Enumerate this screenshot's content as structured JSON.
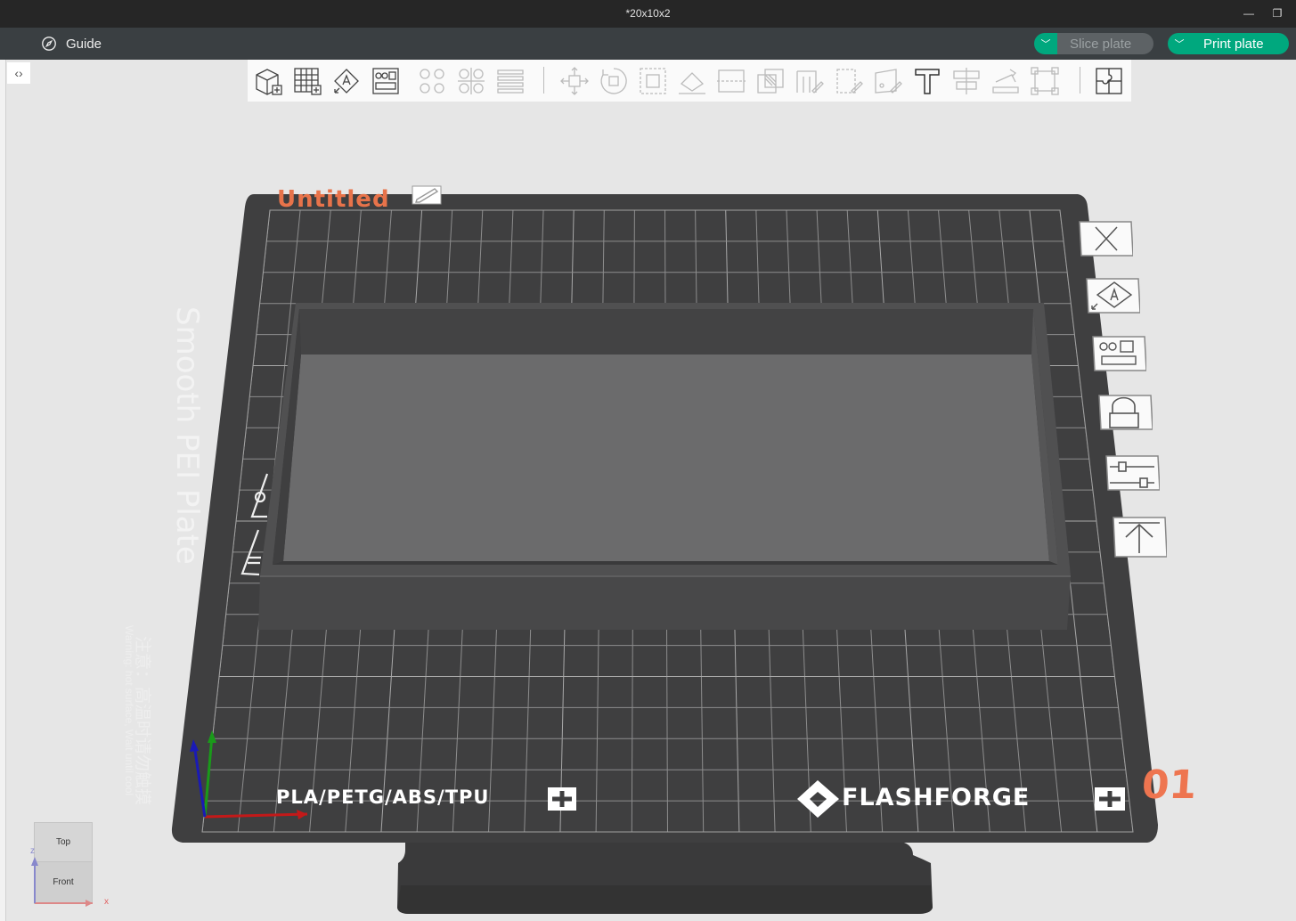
{
  "window": {
    "title": "*20x10x2",
    "minimize_glyph": "—",
    "restore_glyph": "❐"
  },
  "menubar": {
    "guide_label": "Guide",
    "guide_icon": "compass-icon",
    "slice_label": "Slice plate",
    "print_label": "Print plate",
    "dropdown_glyph": "﹀",
    "accent_color": "#00a87e",
    "disabled_color": "#5d6265"
  },
  "sidebar": {
    "collapse_glyph": "‹›"
  },
  "toolbar": {
    "groups": [
      [
        "add-cube-icon",
        "add-plate-icon",
        "auto-orient-icon",
        "arrange-icon"
      ],
      [
        "split-objects-icon",
        "split-parts-icon",
        "layers-icon"
      ],
      [
        "move-icon",
        "rotate-icon",
        "scale-icon",
        "lay-on-face-icon",
        "cut-icon",
        "mesh-boolean-icon",
        "support-paint-icon",
        "seam-paint-icon",
        "color-paint-icon",
        "text-icon",
        "measure-icon",
        "assembly-icon",
        "bounding-box-icon"
      ],
      [
        "puzzle-icon"
      ]
    ]
  },
  "plate": {
    "name": "Untitled",
    "type_label": "Smooth PEI Plate",
    "materials": "PLA/PETG/ABS/TPU",
    "brand": "FLASHFORGE",
    "number": "01",
    "warning_en": "Warning: hot surface, Wait until cool",
    "warning_cn": "注意：高温时请勿触摸",
    "number_color": "#ee7550",
    "side_buttons": [
      "close-plate-icon",
      "auto-orient-plate-icon",
      "arrange-plate-icon",
      "lock-plate-icon",
      "plate-settings-icon",
      "move-to-top-icon"
    ]
  },
  "viewcube": {
    "top_label": "Top",
    "front_label": "Front",
    "axis_x": "x",
    "axis_z": "z"
  }
}
